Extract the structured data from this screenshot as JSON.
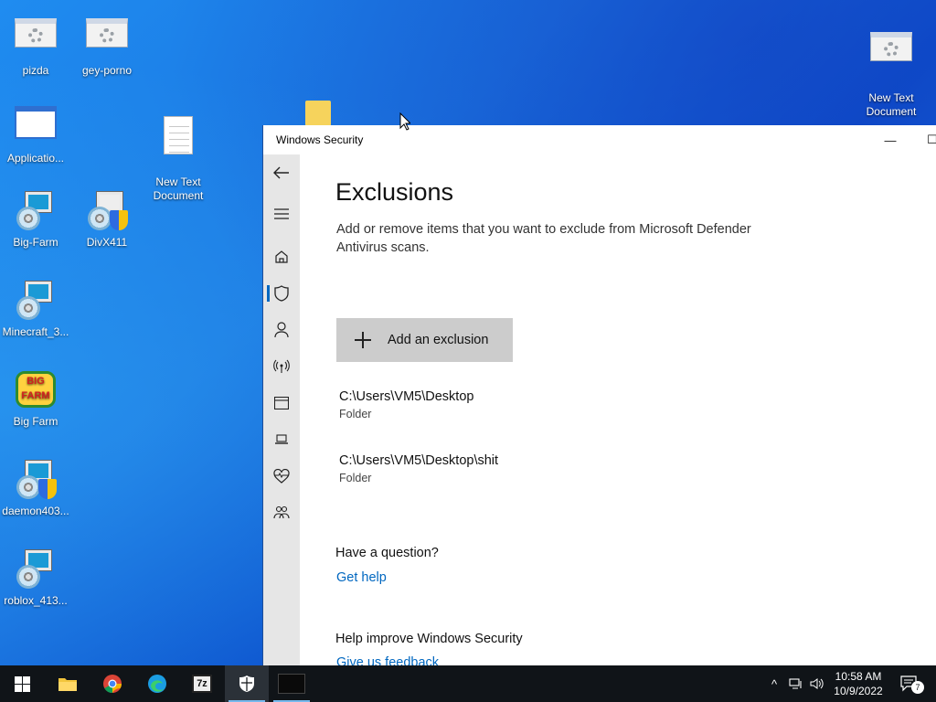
{
  "desktop": {
    "icons": [
      {
        "label": "pizda"
      },
      {
        "label": "gey-porno"
      },
      {
        "label": "New Text\nDocument"
      },
      {
        "label": "Applicatio..."
      },
      {
        "label": "New Text\nDocument"
      },
      {
        "label": "Big-Farm"
      },
      {
        "label": "DivX411"
      },
      {
        "label": "Minecraft_3..."
      },
      {
        "label": "Big Farm"
      },
      {
        "label": "daemon403..."
      },
      {
        "label": "roblox_413..."
      }
    ]
  },
  "window": {
    "title": "Windows Security",
    "controls": {
      "minimize": "—",
      "maximize": "☐"
    },
    "nav": {
      "back": "back-arrow-icon",
      "items": [
        "menu-icon",
        "home-icon",
        "shield-icon",
        "account-icon",
        "wifi-icon",
        "app-browser-icon",
        "laptop-icon",
        "heart-icon",
        "family-icon"
      ],
      "active": "shield-icon"
    },
    "page": {
      "title": "Exclusions",
      "description": "Add or remove items that you want to exclude from Microsoft Defender Antivirus scans.",
      "add_button": "Add an exclusion",
      "exclusions": [
        {
          "path": "C:\\Users\\VM5\\Desktop",
          "type": "Folder"
        },
        {
          "path": "C:\\Users\\VM5\\Desktop\\shit",
          "type": "Folder"
        }
      ],
      "question_heading": "Have a question?",
      "get_help": "Get help",
      "improve_heading": "Help improve Windows Security",
      "feedback": "Give us feedback"
    }
  },
  "taskbar": {
    "pinned": [
      "start-icon",
      "file-explorer-icon",
      "chrome-icon",
      "edge-icon",
      "7zip-icon",
      "windows-security-icon",
      "terminal-app-icon"
    ],
    "sevenzip_label": "7z",
    "tray_chevron": "^",
    "clock": {
      "time": "10:58 AM",
      "date": "10/9/2022"
    },
    "notifications_count": "7"
  },
  "colors": {
    "accent": "#0067c0",
    "taskbar": "#101418",
    "nav": "#e6e6e6",
    "button": "#cccccc"
  }
}
